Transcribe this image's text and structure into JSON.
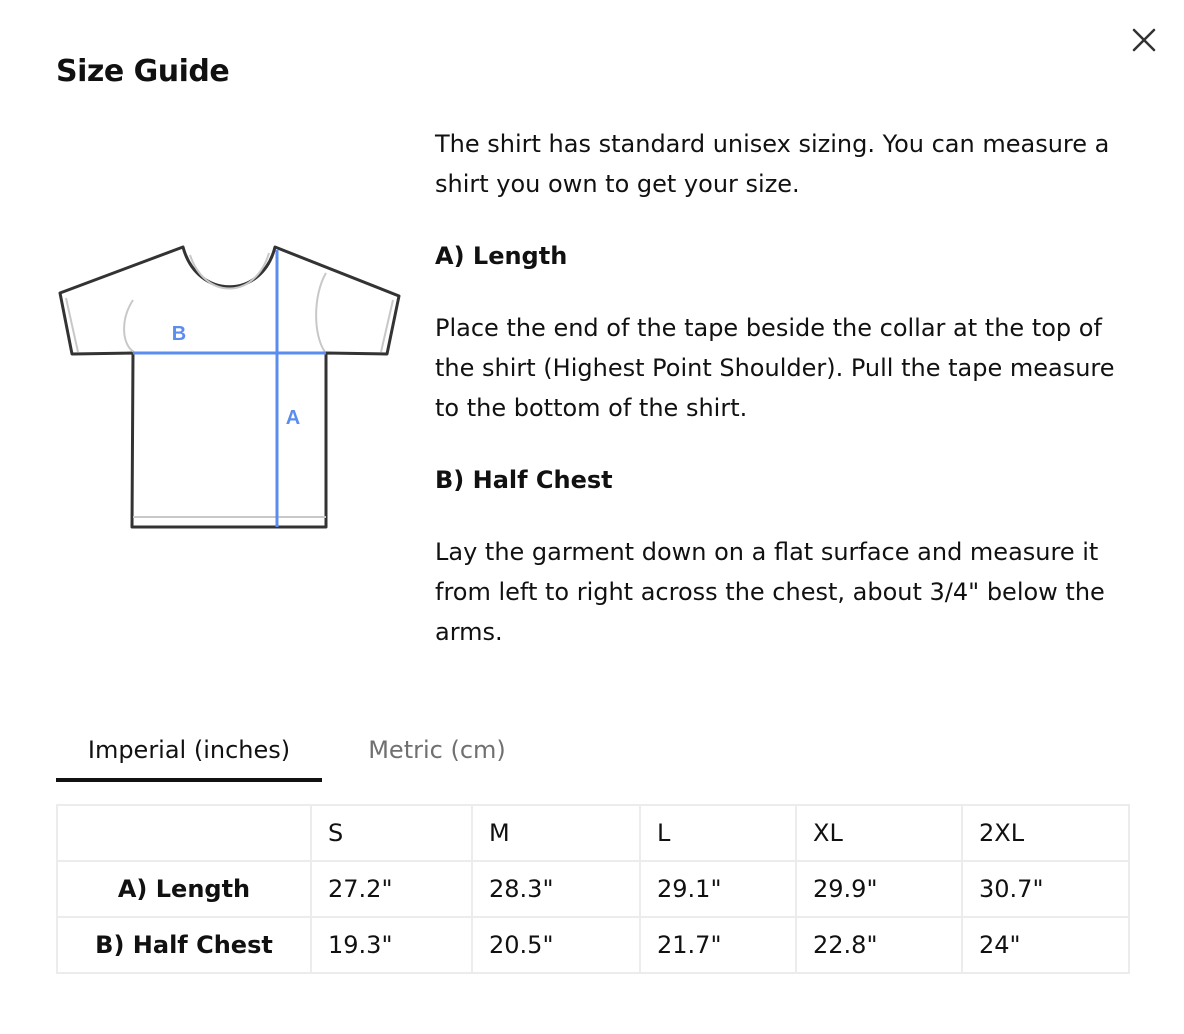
{
  "modal": {
    "title": "Size Guide",
    "close_icon": "close-icon"
  },
  "diagram": {
    "label_a": "A",
    "label_b": "B",
    "measure_color": "#5b8def"
  },
  "description": {
    "intro": "The shirt has standard unisex sizing. You can measure a shirt you own to get your size.",
    "length_heading": "A) Length",
    "length_text": "Place the end of the tape beside the collar at the top of the shirt (Highest Point Shoulder). Pull the tape measure to the bottom of the shirt.",
    "chest_heading": "B) Half Chest",
    "chest_text": "Lay the garment down on a flat surface and measure it from left to right across the chest, about 3/4\" below the arms."
  },
  "tabs": [
    {
      "label": "Imperial (inches)",
      "active": true
    },
    {
      "label": "Metric (cm)",
      "active": false
    }
  ],
  "table": {
    "corner": "",
    "sizes": [
      "S",
      "M",
      "L",
      "XL",
      "2XL"
    ],
    "rows": [
      {
        "label": "A) Length",
        "values": [
          "27.2\"",
          "28.3\"",
          "29.1\"",
          "29.9\"",
          "30.7\""
        ]
      },
      {
        "label": "B) Half Chest",
        "values": [
          "19.3\"",
          "20.5\"",
          "21.7\"",
          "22.8\"",
          "24\""
        ]
      }
    ]
  }
}
